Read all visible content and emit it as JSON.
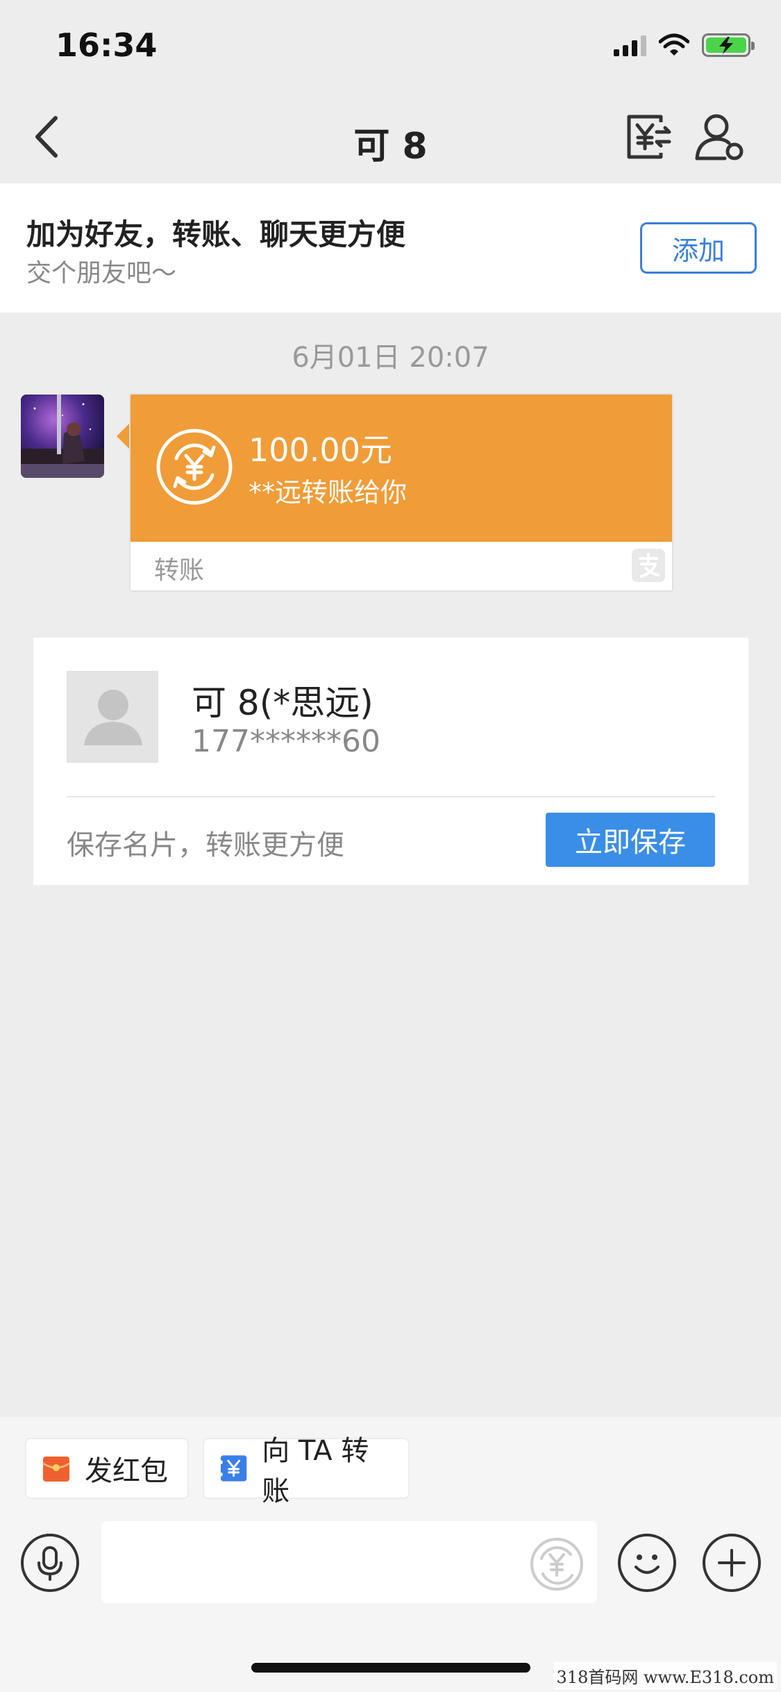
{
  "status_bar": {
    "time": "16:34"
  },
  "nav": {
    "title": "可 8"
  },
  "banner": {
    "title": "加为好友，转账、聊天更方便",
    "subtitle": "交个朋友吧～",
    "add_label": "添加"
  },
  "chat": {
    "timestamp": "6月01日 20:07",
    "transfer": {
      "amount": "100.00元",
      "description": "**远转账给你",
      "label": "转账",
      "color": "#f09c38"
    }
  },
  "contact_card": {
    "name": "可 8(*思远)",
    "phone": "177******60",
    "hint": "保存名片，转账更方便",
    "save_label": "立即保存"
  },
  "quick_actions": [
    {
      "label": "发红包",
      "icon": "red-packet-icon",
      "color": "#f0602e"
    },
    {
      "label": "向 TA 转账",
      "icon": "transfer-card-icon",
      "color": "#3a7fe8"
    }
  ],
  "watermark": "318首码网 www.E318.com",
  "icons": {
    "back": "chevron-left-icon",
    "transfer": "yuan-transfer-icon",
    "profile": "user-settings-icon",
    "voice": "microphone-icon",
    "emoji": "smiley-icon",
    "plus": "plus-icon"
  }
}
